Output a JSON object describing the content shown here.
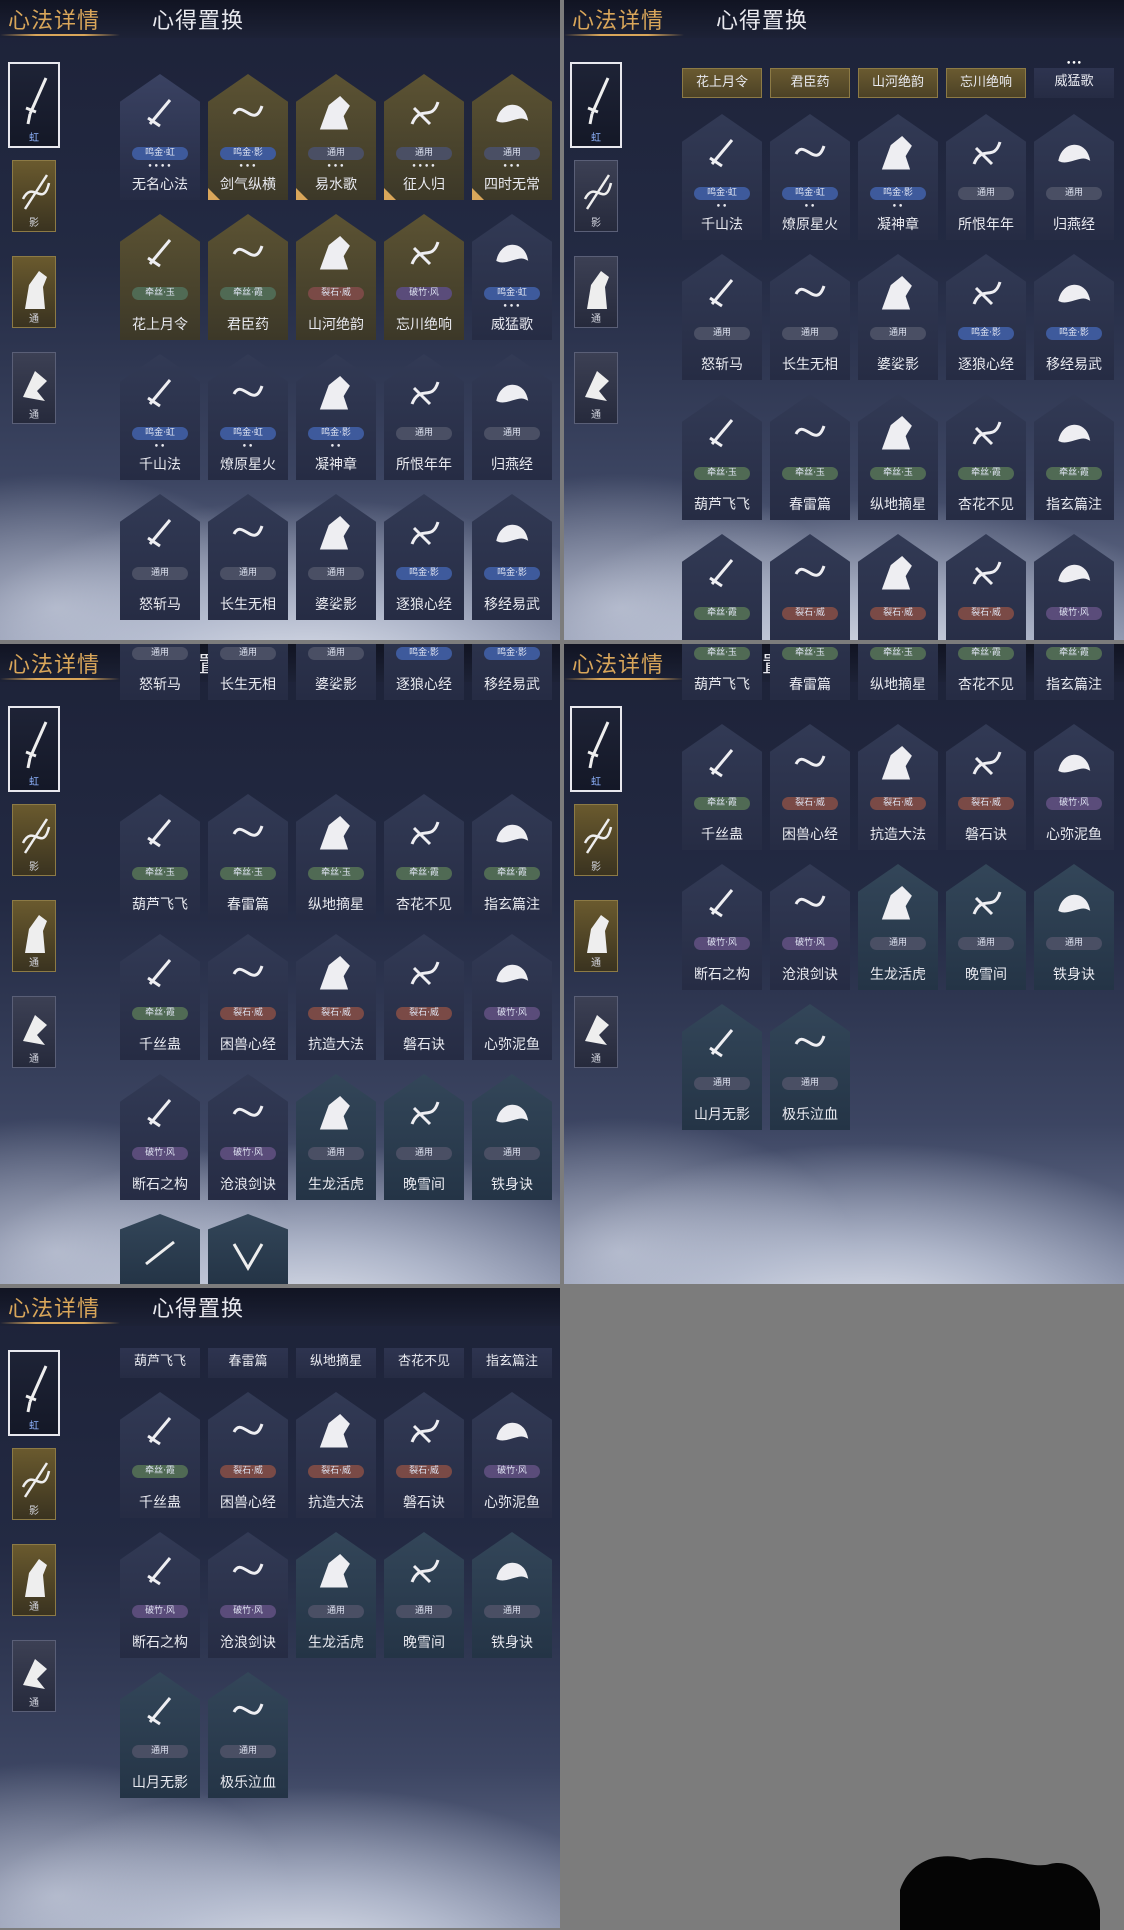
{
  "header": {
    "tab_detail": "心法详情",
    "tab_swap": "心得置换"
  },
  "sidebar": [
    {
      "mark": "虹"
    },
    {
      "mark": "影"
    },
    {
      "mark": "通"
    },
    {
      "mark": "通"
    }
  ],
  "panel0": {
    "cards": [
      {
        "name": "无名心法",
        "tag": "鸣金·虹",
        "dots": "••••"
      },
      {
        "name": "剑气纵横",
        "tag": "鸣金·影",
        "dots": "•••"
      },
      {
        "name": "易水歌",
        "tag": "通用",
        "dots": "•••"
      },
      {
        "name": "征人归",
        "tag": "通用",
        "dots": "••••"
      },
      {
        "name": "四时无常",
        "tag": "通用",
        "dots": "•••"
      },
      {
        "name": "花上月令",
        "tag": "牵丝·玉",
        "dots": ""
      },
      {
        "name": "君臣药",
        "tag": "牵丝·霞",
        "dots": ""
      },
      {
        "name": "山河绝韵",
        "tag": "裂石·威",
        "dots": ""
      },
      {
        "name": "忘川绝响",
        "tag": "破竹·风",
        "dots": ""
      },
      {
        "name": "威猛歌",
        "tag": "鸣金·虹",
        "dots": "•••"
      },
      {
        "name": "千山法",
        "tag": "鸣金·虹",
        "dots": "••"
      },
      {
        "name": "燎原星火",
        "tag": "鸣金·虹",
        "dots": "••"
      },
      {
        "name": "凝神章",
        "tag": "鸣金·影",
        "dots": "••"
      },
      {
        "name": "所恨年年",
        "tag": "通用",
        "dots": ""
      },
      {
        "name": "归燕经",
        "tag": "通用",
        "dots": ""
      },
      {
        "name": "怒斩马",
        "tag": "通用",
        "dots": ""
      },
      {
        "name": "长生无相",
        "tag": "通用",
        "dots": ""
      },
      {
        "name": "婆娑影",
        "tag": "通用",
        "dots": ""
      },
      {
        "name": "逐狼心经",
        "tag": "鸣金·影",
        "dots": ""
      },
      {
        "name": "移经易武",
        "tag": "鸣金·影",
        "dots": ""
      }
    ]
  },
  "panel1": {
    "strips": [
      "花上月令",
      "君臣药",
      "山河绝韵",
      "忘川绝响",
      "威猛歌"
    ],
    "strip_dots": "•••",
    "cards": [
      {
        "name": "千山法",
        "tag": "鸣金·虹",
        "dots": "••"
      },
      {
        "name": "燎原星火",
        "tag": "鸣金·虹",
        "dots": "••"
      },
      {
        "name": "凝神章",
        "tag": "鸣金·影",
        "dots": "••"
      },
      {
        "name": "所恨年年",
        "tag": "通用",
        "dots": ""
      },
      {
        "name": "归燕经",
        "tag": "通用",
        "dots": ""
      },
      {
        "name": "怒斩马",
        "tag": "通用",
        "dots": ""
      },
      {
        "name": "长生无相",
        "tag": "通用",
        "dots": ""
      },
      {
        "name": "婆娑影",
        "tag": "通用",
        "dots": ""
      },
      {
        "name": "逐狼心经",
        "tag": "鸣金·影",
        "dots": ""
      },
      {
        "name": "移经易武",
        "tag": "鸣金·影",
        "dots": ""
      },
      {
        "name": "葫芦飞飞",
        "tag": "牵丝·玉",
        "dots": ""
      },
      {
        "name": "春雷篇",
        "tag": "牵丝·玉",
        "dots": ""
      },
      {
        "name": "纵地摘星",
        "tag": "牵丝·玉",
        "dots": ""
      },
      {
        "name": "杏花不见",
        "tag": "牵丝·霞",
        "dots": ""
      },
      {
        "name": "指玄篇注",
        "tag": "牵丝·霞",
        "dots": ""
      },
      {
        "name": "",
        "tag": "牵丝·霞",
        "dots": ""
      },
      {
        "name": "",
        "tag": "裂石·威",
        "dots": ""
      },
      {
        "name": "",
        "tag": "裂石·威",
        "dots": ""
      },
      {
        "name": "",
        "tag": "裂石·威",
        "dots": ""
      },
      {
        "name": "",
        "tag": "破竹·风",
        "dots": ""
      }
    ]
  },
  "panel2": {
    "top_names": [
      "怒斩马",
      "长生无相",
      "婆娑影",
      "逐狼心经",
      "移经易武"
    ],
    "top_tags": [
      "通用",
      "通用",
      "通用",
      "鸣金·影",
      "鸣金·影"
    ],
    "cards": [
      {
        "name": "葫芦飞飞",
        "tag": "牵丝·玉"
      },
      {
        "name": "春雷篇",
        "tag": "牵丝·玉"
      },
      {
        "name": "纵地摘星",
        "tag": "牵丝·玉"
      },
      {
        "name": "杏花不见",
        "tag": "牵丝·霞"
      },
      {
        "name": "指玄篇注",
        "tag": "牵丝·霞"
      },
      {
        "name": "千丝蛊",
        "tag": "牵丝·霞"
      },
      {
        "name": "困兽心经",
        "tag": "裂石·威"
      },
      {
        "name": "抗造大法",
        "tag": "裂石·威"
      },
      {
        "name": "磐石诀",
        "tag": "裂石·威"
      },
      {
        "name": "心弥泥鱼",
        "tag": "破竹·风"
      },
      {
        "name": "断石之构",
        "tag": "破竹·风"
      },
      {
        "name": "沧浪剑诀",
        "tag": "破竹·风"
      },
      {
        "name": "生龙活虎",
        "tag": "通用"
      },
      {
        "name": "晚雪间",
        "tag": "通用"
      },
      {
        "name": "铁身诀",
        "tag": "通用"
      }
    ]
  },
  "panel3": {
    "top_names": [
      "葫芦飞飞",
      "春雷篇",
      "纵地摘星",
      "杏花不见",
      "指玄篇注"
    ],
    "top_tags": [
      "牵丝·玉",
      "牵丝·玉",
      "牵丝·玉",
      "牵丝·霞",
      "牵丝·霞"
    ],
    "cards": [
      {
        "name": "千丝蛊",
        "tag": "牵丝·霞"
      },
      {
        "name": "困兽心经",
        "tag": "裂石·威"
      },
      {
        "name": "抗造大法",
        "tag": "裂石·威"
      },
      {
        "name": "磐石诀",
        "tag": "裂石·威"
      },
      {
        "name": "心弥泥鱼",
        "tag": "破竹·风"
      },
      {
        "name": "断石之构",
        "tag": "破竹·风"
      },
      {
        "name": "沧浪剑诀",
        "tag": "破竹·风"
      },
      {
        "name": "生龙活虎",
        "tag": "通用"
      },
      {
        "name": "晚雪间",
        "tag": "通用"
      },
      {
        "name": "铁身诀",
        "tag": "通用"
      },
      {
        "name": "山月无影",
        "tag": "通用"
      },
      {
        "name": "极乐泣血",
        "tag": "通用"
      }
    ]
  },
  "panel4": {
    "strips": [
      "葫芦飞飞",
      "春雷篇",
      "纵地摘星",
      "杏花不见",
      "指玄篇注"
    ],
    "cards": [
      {
        "name": "千丝蛊",
        "tag": "牵丝·霞"
      },
      {
        "name": "困兽心经",
        "tag": "裂石·威"
      },
      {
        "name": "抗造大法",
        "tag": "裂石·威"
      },
      {
        "name": "磐石诀",
        "tag": "裂石·威"
      },
      {
        "name": "心弥泥鱼",
        "tag": "破竹·风"
      },
      {
        "name": "断石之构",
        "tag": "破竹·风"
      },
      {
        "name": "沧浪剑诀",
        "tag": "破竹·风"
      },
      {
        "name": "生龙活虎",
        "tag": "通用"
      },
      {
        "name": "晚雪间",
        "tag": "通用"
      },
      {
        "name": "铁身诀",
        "tag": "通用"
      },
      {
        "name": "山月无影",
        "tag": "通用"
      },
      {
        "name": "极乐泣血",
        "tag": "通用"
      }
    ]
  },
  "colors": {
    "gold": "#d9a65a",
    "text": "#e9eaf0",
    "blue_tag": "#3e5a9c",
    "green_tag": "#506a54",
    "brown_tag": "#7a4a46",
    "purple_tag": "#5a4c7a"
  }
}
